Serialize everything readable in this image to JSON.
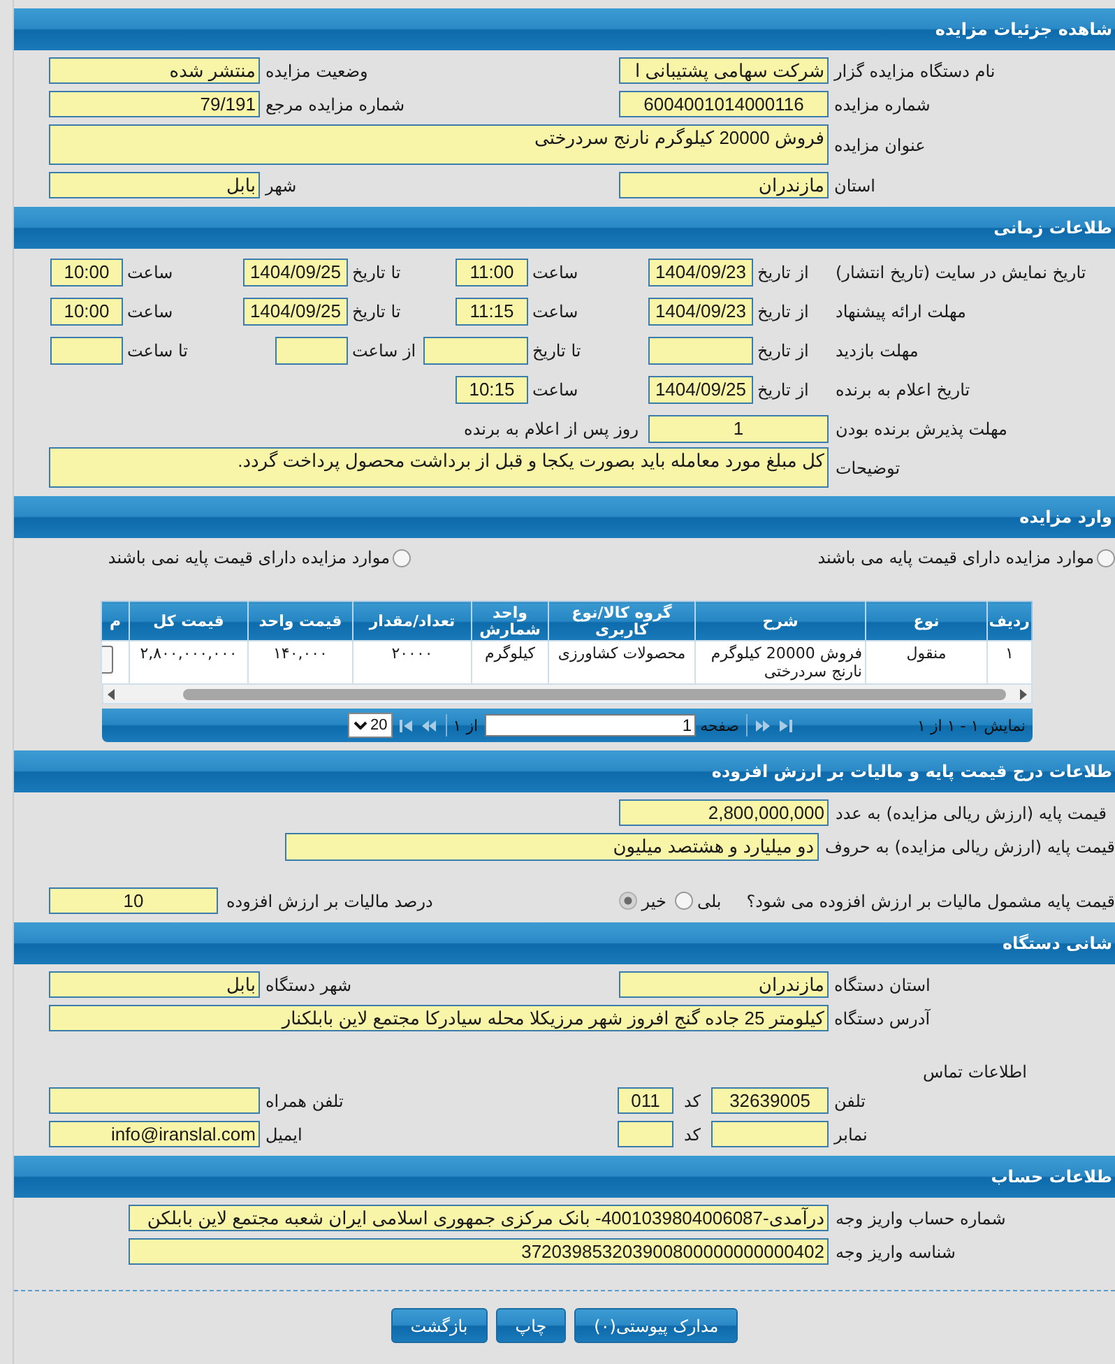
{
  "details": {
    "title": "شاهده جزئیات مزایده",
    "fields": [
      {
        "label": "نام دستگاه مزایده گزار",
        "value": "شرکت سهامی پشتیبانی ا",
        "kind": "text"
      },
      {
        "label": "وضعیت مزایده",
        "value": "منتشر شده",
        "kind": "text"
      },
      {
        "label": "شماره مزایده",
        "value": "6004001014000116",
        "kind": "code"
      },
      {
        "label": "شماره مزایده مرجع",
        "value": "79/191",
        "kind": "text"
      },
      {
        "label": "عنوان مزایده",
        "value": "فروش 20000 کیلوگرم نارنج سردرختی",
        "kind": "area"
      },
      {
        "label": "استان",
        "value": "مازندران",
        "kind": "text"
      },
      {
        "label": "شهر",
        "value": "بابل",
        "kind": "text"
      }
    ]
  },
  "schedule": {
    "title": "طلاعات زمانی",
    "rows": [
      {
        "kind": "dates",
        "label": "تاریخ نمایش در سایت (تاریخ انتشار)",
        "fields": [
          {
            "label": "از تاریخ",
            "value": "1404/09/23",
            "kind": "date"
          },
          {
            "label": "ساعت",
            "value": "11:00",
            "kind": "time"
          },
          {
            "label": "تا تاریخ",
            "value": "1404/09/25",
            "kind": "date"
          },
          {
            "label": "ساعت",
            "value": "10:00",
            "kind": "time"
          }
        ]
      },
      {
        "kind": "dates",
        "label": "مهلت ارائه پیشنهاد",
        "fields": [
          {
            "label": "از تاریخ",
            "value": "1404/09/23",
            "kind": "date"
          },
          {
            "label": "ساعت",
            "value": "11:15",
            "kind": "time"
          },
          {
            "label": "تا تاریخ",
            "value": "1404/09/25",
            "kind": "date"
          },
          {
            "label": "ساعت",
            "value": "10:00",
            "kind": "time"
          }
        ]
      },
      {
        "kind": "dates",
        "label": "مهلت بازدید",
        "fields": [
          {
            "label": "از تاریخ",
            "kind": "date"
          },
          {
            "label": "تا تاریخ",
            "kind": "date"
          },
          {
            "label": "از ساعت",
            "kind": "time"
          },
          {
            "label": "تا ساعت",
            "kind": "time"
          }
        ]
      },
      {
        "kind": "dates",
        "label": "تاریخ اعلام به برنده",
        "fields": [
          {
            "label": "از تاریخ",
            "value": "1404/09/25",
            "kind": "date"
          },
          {
            "label": "ساعت",
            "value": "10:15",
            "kind": "time"
          }
        ]
      },
      {
        "kind": "days",
        "label": "مهلت پذیرش برنده بودن",
        "value": "1",
        "suffix": "روز پس از اعلام به برنده"
      },
      {
        "kind": "note",
        "label": "توضیحات",
        "value": "کل مبلغ مورد معامله باید بصورت یکجا و قبل از برداشت محصول پرداخت گردد."
      }
    ]
  },
  "items": {
    "title": "وارد مزایده",
    "options": [
      {
        "label": "موارد مزایده دارای قیمت پایه می باشند",
        "selected": false
      },
      {
        "label": "موارد مزایده دارای قیمت پایه نمی باشند",
        "selected": false
      }
    ],
    "table": {
      "columns": [
        "ردیف",
        "نوع",
        "شرح",
        "گروه کالا/نوع کاربری",
        "واحد شمارش",
        "تعداد/مقدار",
        "قیمت واحد",
        "قیمت کل",
        "م"
      ],
      "rows": [
        {
          "cells": [
            "۱",
            "منقول",
            "فروش 20000 کیلوگرم نارنج سردرختی",
            "محصولات کشاورزی",
            "کیلوگرم",
            "۲۰۰۰۰",
            "۱۴۰,۰۰۰",
            "۲,۸۰۰,۰۰۰,۰۰۰"
          ]
        }
      ]
    },
    "pager": {
      "summary": "نمایش ۱ - ۱ از ۱",
      "page_label": "صفحه",
      "page": "1",
      "total": "از ۱",
      "page_size": "20"
    }
  },
  "pricing": {
    "title": "طلاعات درج قیمت پایه و مالیات بر ارزش افزوده",
    "fields": [
      {
        "label": "قیمت پایه (ارزش ریالی مزایده) به عدد",
        "value": "2,800,000,000",
        "kind": "short"
      },
      {
        "label": "قیمت پایه (ارزش ریالی مزایده) به حروف",
        "value": "دو میلیارد و هشتصد میلیون",
        "kind": "long"
      }
    ],
    "vat": {
      "label": "قیمت پایه مشمول مالیات بر ارزش افزوده می شود؟",
      "options": [
        {
          "label": "بلی",
          "selected": false
        },
        {
          "label": "خیر",
          "selected": true
        }
      ],
      "rate_label": "درصد مالیات بر ارزش افزوده",
      "rate": "10"
    }
  },
  "address": {
    "title": "شانی دستگاه",
    "fields": [
      {
        "label": "استان دستگاه",
        "value": "مازندران",
        "kind": "text"
      },
      {
        "label": "شهر دستگاه",
        "value": "بابل",
        "kind": "text"
      },
      {
        "label": "آدرس دستگاه",
        "value": "کیلومتر 25 جاده گنج افروز شهر مرزیکلا محله سیادرکا مجتمع لاین بابلکنار",
        "kind": "wide"
      }
    ],
    "contact": {
      "title": "اطلاعات تماس",
      "rows": [
        {
          "label": "تلفن",
          "value": "32639005",
          "code_label": "کد",
          "code": "011",
          "extra_label": "تلفن همراه"
        },
        {
          "label": "نمابر",
          "code_label": "کد",
          "extra_label": "ایمیل",
          "extra": "info@iranslal.com"
        }
      ]
    }
  },
  "account": {
    "title": "طلاعات حساب",
    "fields": [
      {
        "label": "شماره حساب واریز وجه",
        "value": "درآمدی-4001039804006087- بانک مرکزی جمهوری اسلامی ایران شعبه مجتمع لاین بابلکن"
      },
      {
        "label": "شناسه واریز وجه",
        "value": "372039853203900800000000000402"
      }
    ]
  },
  "buttons": [
    "مدارک پیوستی(۰)",
    "چاپ",
    "بازگشت"
  ]
}
